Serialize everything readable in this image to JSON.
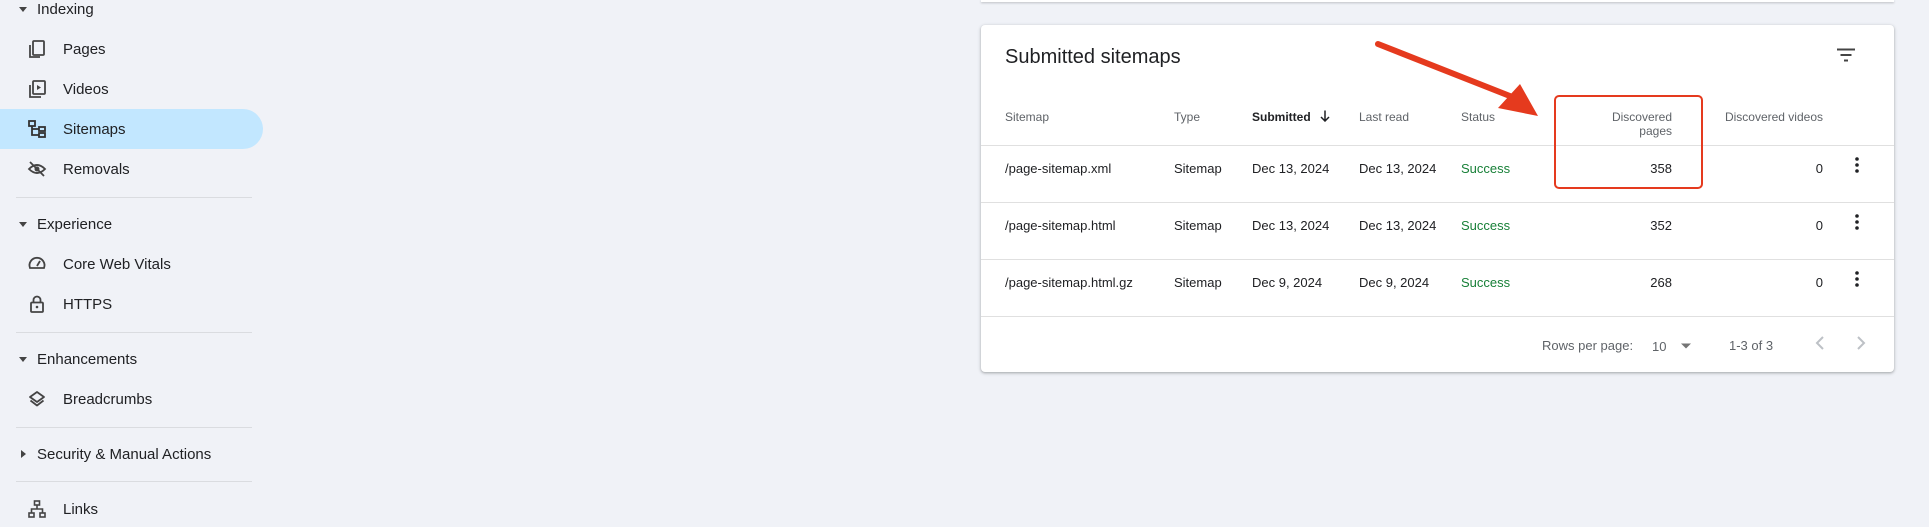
{
  "sidebar": {
    "sections": [
      {
        "label": "Indexing",
        "expanded": true
      },
      {
        "label": "Experience",
        "expanded": true
      },
      {
        "label": "Enhancements",
        "expanded": true
      },
      {
        "label": "Security & Manual Actions",
        "expanded": false
      }
    ],
    "items": [
      {
        "label": "Pages",
        "icon": "pages-icon"
      },
      {
        "label": "Videos",
        "icon": "videos-icon"
      },
      {
        "label": "Sitemaps",
        "icon": "sitemaps-icon",
        "active": true
      },
      {
        "label": "Removals",
        "icon": "removals-icon"
      },
      {
        "label": "Core Web Vitals",
        "icon": "gauge-icon"
      },
      {
        "label": "HTTPS",
        "icon": "lock-icon"
      },
      {
        "label": "Breadcrumbs",
        "icon": "layers-icon"
      },
      {
        "label": "Links",
        "icon": "links-icon"
      }
    ]
  },
  "card": {
    "title": "Submitted sitemaps",
    "columns": [
      "Sitemap",
      "Type",
      "Submitted",
      "Last read",
      "Status",
      "Discovered pages",
      "Discovered videos"
    ],
    "sorted_column": "Submitted",
    "rows": [
      {
        "sitemap": "/page-sitemap.xml",
        "type": "Sitemap",
        "submitted": "Dec 13, 2024",
        "last_read": "Dec 13, 2024",
        "status": "Success",
        "pages": "358",
        "videos": "0"
      },
      {
        "sitemap": "/page-sitemap.html",
        "type": "Sitemap",
        "submitted": "Dec 13, 2024",
        "last_read": "Dec 13, 2024",
        "status": "Success",
        "pages": "352",
        "videos": "0"
      },
      {
        "sitemap": "/page-sitemap.html.gz",
        "type": "Sitemap",
        "submitted": "Dec 9, 2024",
        "last_read": "Dec 9, 2024",
        "status": "Success",
        "pages": "268",
        "videos": "0"
      }
    ],
    "footer": {
      "rows_per_page_label": "Rows per page:",
      "rows_per_page_value": "10",
      "range": "1-3 of 3"
    }
  },
  "colors": {
    "accent_active": "#c2e7ff",
    "status_success": "#188038",
    "annotation": "#e53a1e"
  }
}
